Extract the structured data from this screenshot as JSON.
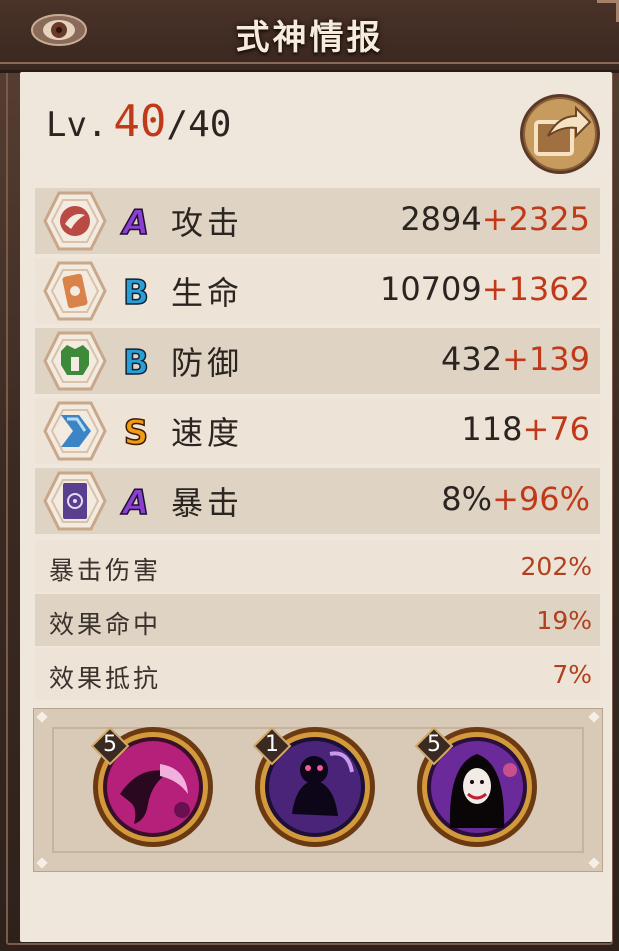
{
  "header": {
    "title": "式神情报"
  },
  "level": {
    "label": "Lv.",
    "current": "40",
    "separator": "/",
    "max": "40"
  },
  "stats": [
    {
      "icon": "attack-icon",
      "grade": "A",
      "name": "攻击",
      "base": "2894",
      "bonus": "+2325"
    },
    {
      "icon": "hp-icon",
      "grade": "B",
      "name": "生命",
      "base": "10709",
      "bonus": "+1362"
    },
    {
      "icon": "defense-icon",
      "grade": "B",
      "name": "防御",
      "base": "432",
      "bonus": "+139"
    },
    {
      "icon": "speed-icon",
      "grade": "S",
      "name": "速度",
      "base": "118",
      "bonus": "+76"
    },
    {
      "icon": "crit-icon",
      "grade": "A",
      "name": "暴击",
      "base": "8%",
      "bonus": "+96%"
    }
  ],
  "secondary_stats": [
    {
      "name": "暴击伤害",
      "value": "202%"
    },
    {
      "name": "效果命中",
      "value": "19%"
    },
    {
      "name": "效果抵抗",
      "value": "7%"
    }
  ],
  "skills": [
    {
      "icon": "skill-slash-icon",
      "level": "5"
    },
    {
      "icon": "skill-spirit-icon",
      "level": "1"
    },
    {
      "icon": "skill-ghost-woman-icon",
      "level": "5"
    }
  ],
  "colors": {
    "accent": "#c03a1a",
    "panel": "#f0e7dc",
    "row_dark": "#dfd3c3",
    "frame": "#3a2a22"
  }
}
